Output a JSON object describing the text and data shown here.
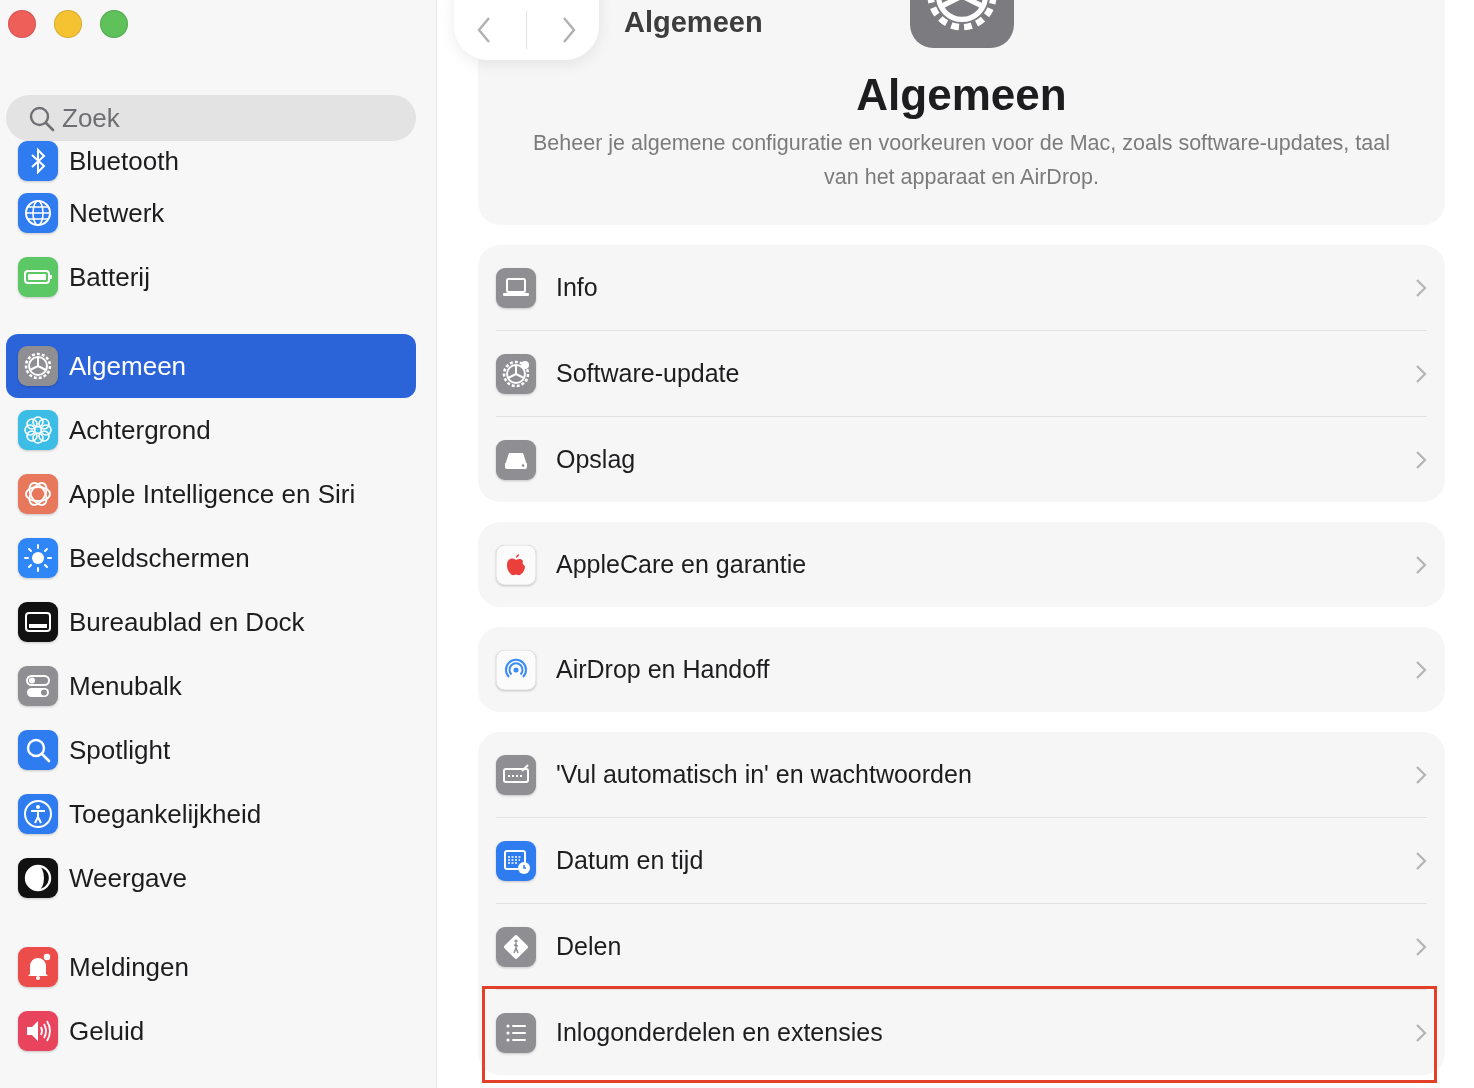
{
  "window": {
    "title": "Algemeen"
  },
  "sidebar": {
    "search": {
      "placeholder": "Zoek"
    },
    "groups": [
      {
        "items": [
          {
            "label": "Bluetooth",
            "selected": false
          },
          {
            "label": "Netwerk",
            "selected": false
          },
          {
            "label": "Batterij",
            "selected": false
          }
        ]
      },
      {
        "items": [
          {
            "label": "Algemeen",
            "selected": true
          },
          {
            "label": "Achtergrond",
            "selected": false
          },
          {
            "label": "Apple Intelligence en Siri",
            "selected": false
          },
          {
            "label": "Beeldschermen",
            "selected": false
          },
          {
            "label": "Bureaublad en Dock",
            "selected": false
          },
          {
            "label": "Menubalk",
            "selected": false
          },
          {
            "label": "Spotlight",
            "selected": false
          },
          {
            "label": "Toegankelijkheid",
            "selected": false
          },
          {
            "label": "Weergave",
            "selected": false
          }
        ]
      },
      {
        "items": [
          {
            "label": "Meldingen",
            "selected": false
          },
          {
            "label": "Geluid",
            "selected": false
          }
        ]
      }
    ]
  },
  "header": {
    "title": "Algemeen",
    "description": "Beheer je algemene configuratie en voorkeuren voor de Mac, zoals software-updates, taal van het apparaat en AirDrop."
  },
  "groups": [
    {
      "rows": [
        {
          "label": "Info",
          "highlighted": false
        },
        {
          "label": "Software-update",
          "highlighted": false
        },
        {
          "label": "Opslag",
          "highlighted": false
        }
      ]
    },
    {
      "rows": [
        {
          "label": "AppleCare en garantie",
          "highlighted": false
        }
      ]
    },
    {
      "rows": [
        {
          "label": "AirDrop en Handoff",
          "highlighted": false
        }
      ]
    },
    {
      "rows": [
        {
          "label": "'Vul automatisch in' en wachtwoorden",
          "highlighted": false
        },
        {
          "label": "Datum en tijd",
          "highlighted": false
        },
        {
          "label": "Delen",
          "highlighted": false
        },
        {
          "label": "Inlogonderdelen en extensies",
          "highlighted": true
        }
      ]
    }
  ]
}
